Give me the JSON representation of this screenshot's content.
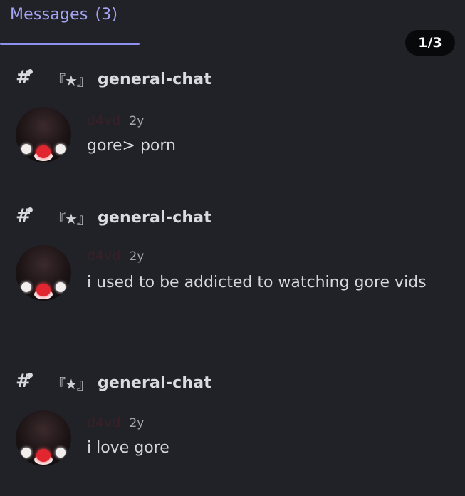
{
  "tab": {
    "label": "Messages",
    "count": "(3)"
  },
  "pager": "1/3",
  "results": [
    {
      "channel_deco": "『★』",
      "channel": "general-chat",
      "author": "d4vd",
      "time": "2y",
      "content": "gore> porn"
    },
    {
      "channel_deco": "『★』",
      "channel": "general-chat",
      "author": "d4vd",
      "time": "2y",
      "content": "i used to be addicted to watching gore vids"
    },
    {
      "channel_deco": "『★』",
      "channel": "general-chat",
      "author": "d4vd",
      "time": "2y",
      "content": "i love gore"
    }
  ],
  "colors": {
    "background": "#212227",
    "accent": "#a3a4f2",
    "author": "#3a1f27"
  },
  "icons": {
    "channel": "hash-thread-icon",
    "avatar": "clown-avatar"
  }
}
